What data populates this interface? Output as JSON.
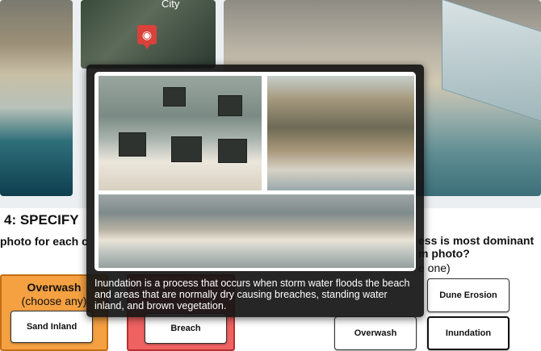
{
  "photo_strip": {
    "map_label": "City",
    "pin_icon": "camera-icon"
  },
  "step": {
    "title": "4: SPECIFY",
    "left_instruction": "photo for each c",
    "question": "ess is most dominant\nm photo?",
    "choose": "e one)"
  },
  "overwash_panel": {
    "title": "Overwash",
    "subtitle": "(choose any)",
    "button": "Sand Inland",
    "color": "#f5a142"
  },
  "breach_panel": {
    "button": "Breach",
    "color": "#ef6262"
  },
  "dominant_buttons": {
    "dune_erosion": "Dune Erosion",
    "overwash": "Overwash",
    "inundation": "Inundation"
  },
  "popup": {
    "caption": "Inundation is a process that occurs when storm water floods the beach and areas that are normally dry causing breaches, standing water inland, and brown vegetation."
  }
}
